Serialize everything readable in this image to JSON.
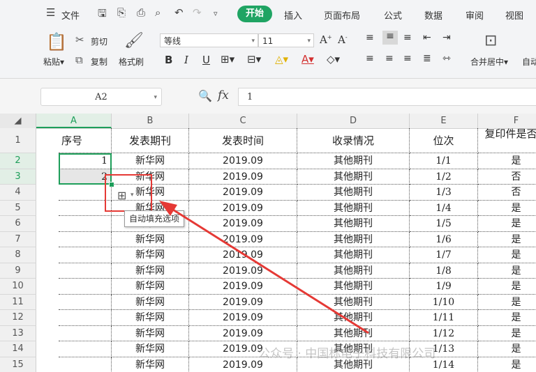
{
  "menu": {
    "file_label": "文件",
    "tabs": [
      "开始",
      "插入",
      "页面布局",
      "公式",
      "数据",
      "审阅",
      "视图"
    ]
  },
  "ribbon": {
    "paste_label": "粘贴",
    "cut_label": "剪切",
    "copy_label": "复制",
    "format_painter_label": "格式刷",
    "font_name": "等线",
    "font_size": "11",
    "merge_center_label": "合并居中",
    "autowrap_partial": "自动"
  },
  "formula_bar": {
    "name_box": "A2",
    "fx_label": "fx",
    "value": "1"
  },
  "sheet": {
    "columns": [
      "A",
      "B",
      "C",
      "D",
      "E",
      "F"
    ],
    "header_row": [
      "序号",
      "发表期刊",
      "发表时间",
      "收录情况",
      "位次",
      "复印件是否交"
    ],
    "rows": [
      {
        "row": "2",
        "a": "1",
        "b": "新华网",
        "c": "2019.09",
        "d": "其他期刊",
        "e": "1/1",
        "f": "是"
      },
      {
        "row": "3",
        "a": "2",
        "b": "新华网",
        "c": "2019.09",
        "d": "其他期刊",
        "e": "1/2",
        "f": "否"
      },
      {
        "row": "4",
        "a": "",
        "b": "新华网",
        "c": "2019.09",
        "d": "其他期刊",
        "e": "1/3",
        "f": "否"
      },
      {
        "row": "5",
        "a": "",
        "b": "新华网",
        "c": "2019.09",
        "d": "其他期刊",
        "e": "1/4",
        "f": "是"
      },
      {
        "row": "6",
        "a": "",
        "b": "新华网",
        "c": "2019.09",
        "d": "其他期刊",
        "e": "1/5",
        "f": "是"
      },
      {
        "row": "7",
        "a": "",
        "b": "新华网",
        "c": "2019.09",
        "d": "其他期刊",
        "e": "1/6",
        "f": "是"
      },
      {
        "row": "8",
        "a": "",
        "b": "新华网",
        "c": "2019.09",
        "d": "其他期刊",
        "e": "1/7",
        "f": "是"
      },
      {
        "row": "9",
        "a": "",
        "b": "新华网",
        "c": "2019.09",
        "d": "其他期刊",
        "e": "1/8",
        "f": "是"
      },
      {
        "row": "10",
        "a": "",
        "b": "新华网",
        "c": "2019.09",
        "d": "其他期刊",
        "e": "1/9",
        "f": "是"
      },
      {
        "row": "11",
        "a": "",
        "b": "新华网",
        "c": "2019.09",
        "d": "其他期刊",
        "e": "1/10",
        "f": "是"
      },
      {
        "row": "12",
        "a": "",
        "b": "新华网",
        "c": "2019.09",
        "d": "其他期刊",
        "e": "1/11",
        "f": "是"
      },
      {
        "row": "13",
        "a": "",
        "b": "新华网",
        "c": "2019.09",
        "d": "其他期刊",
        "e": "1/12",
        "f": "是"
      },
      {
        "row": "14",
        "a": "",
        "b": "新华网",
        "c": "2019.09",
        "d": "其他期刊",
        "e": "1/13",
        "f": "是"
      },
      {
        "row": "15",
        "a": "",
        "b": "新华网",
        "c": "2019.09",
        "d": "其他期刊",
        "e": "1/14",
        "f": "是"
      }
    ]
  },
  "autofill_tooltip": "自动填充选项",
  "watermark": "公众号 · 中国标电子科技有限公司",
  "colors": {
    "accent": "#1fa463",
    "annotation": "#e53935"
  }
}
